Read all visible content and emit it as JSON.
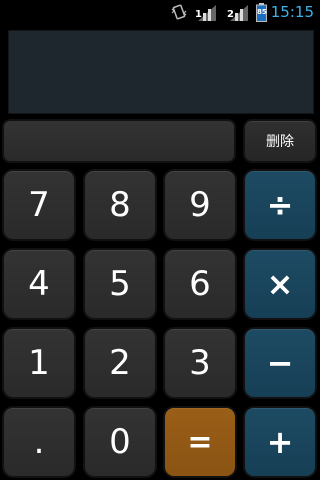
{
  "status_bar": {
    "time": "15:15",
    "icons": [
      "vibrate-icon",
      "signal-1-icon",
      "signal-2-icon",
      "battery-icon"
    ],
    "sim1_label": "1",
    "sim2_label": "2",
    "battery_label": "85"
  },
  "display": {
    "result": "",
    "formula": ""
  },
  "buttons": {
    "delete": "删除",
    "rows": [
      [
        "7",
        "8",
        "9",
        "÷"
      ],
      [
        "4",
        "5",
        "6",
        "×"
      ],
      [
        "1",
        "2",
        "3",
        "−"
      ],
      [
        ".",
        "0",
        "=",
        "+"
      ]
    ]
  },
  "colors": {
    "operator": "#1a4660",
    "equals": "#94591a",
    "digit": "#2e2e2e",
    "time": "#3fb3e6"
  }
}
